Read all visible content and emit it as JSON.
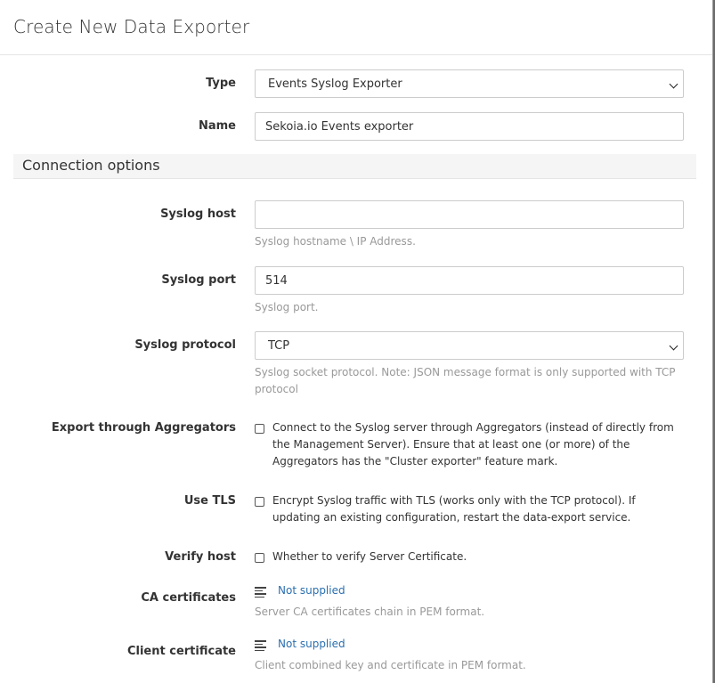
{
  "dialog": {
    "title": "Create New Data Exporter"
  },
  "form": {
    "type": {
      "label": "Type",
      "value": "Events Syslog Exporter"
    },
    "name": {
      "label": "Name",
      "value": "Sekoia.io Events exporter"
    },
    "section_title": "Connection options",
    "syslog_host": {
      "label": "Syslog host",
      "value": "",
      "help": "Syslog hostname \\ IP Address."
    },
    "syslog_port": {
      "label": "Syslog port",
      "value": "514",
      "help": "Syslog port."
    },
    "syslog_protocol": {
      "label": "Syslog protocol",
      "value": "TCP",
      "help": "Syslog socket protocol. Note: JSON message format is only supported with TCP protocol"
    },
    "export_aggregators": {
      "label": "Export through Aggregators",
      "checked": false,
      "text": "Connect to the Syslog server through Aggregators (instead of directly from the Management Server). Ensure that at least one (or more) of the Aggregators has the \"Cluster exporter\" feature mark."
    },
    "use_tls": {
      "label": "Use TLS",
      "checked": false,
      "text": "Encrypt Syslog traffic with TLS (works only with the TCP protocol). If updating an existing configuration, restart the data-export service."
    },
    "verify_host": {
      "label": "Verify host",
      "checked": false,
      "text": "Whether to verify Server Certificate."
    },
    "ca_certificates": {
      "label": "CA certificates",
      "link": "Not supplied",
      "help": "Server CA certificates chain in PEM format."
    },
    "client_certificate": {
      "label": "Client certificate",
      "link": "Not supplied",
      "help": "Client combined key and certificate in PEM format."
    }
  },
  "icons": {
    "file": "text-lines-icon",
    "dropdown": "chevron-down-icon"
  },
  "colors": {
    "link": "#2a6fb0",
    "help_text": "#999999",
    "section_bg": "#f5f5f5"
  }
}
